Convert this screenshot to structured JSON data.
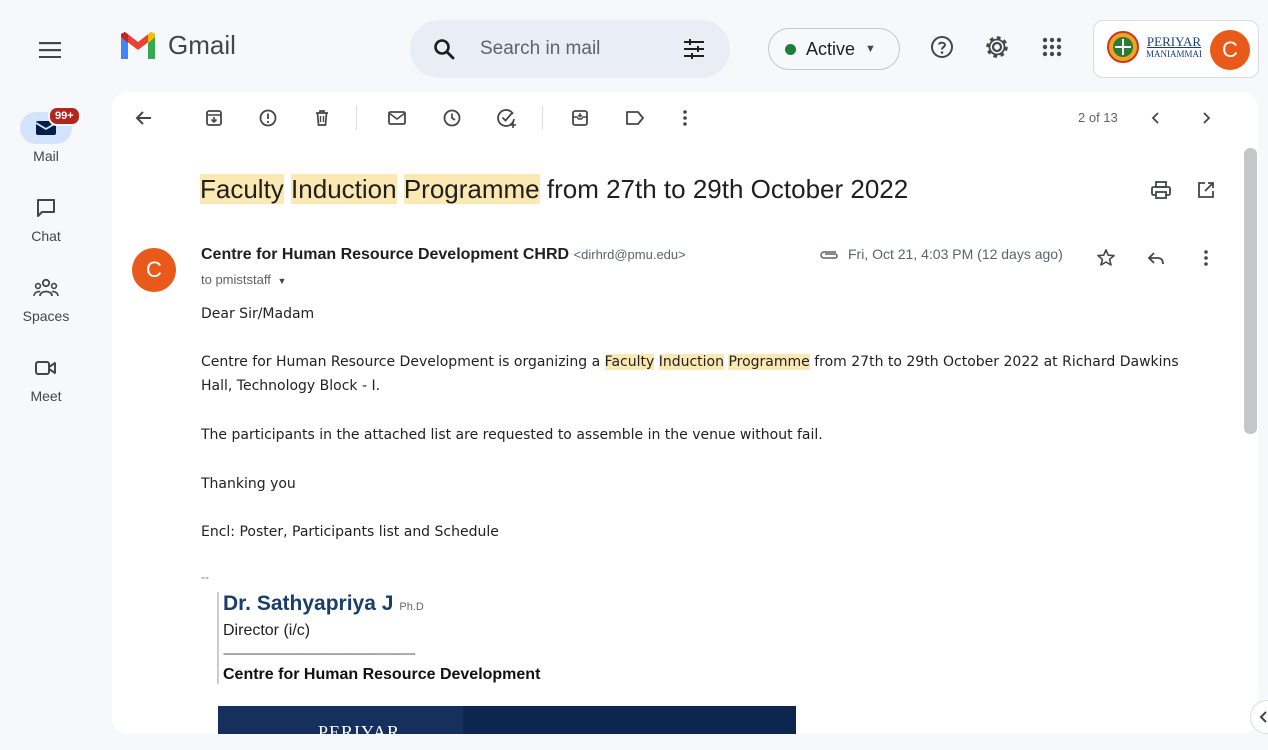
{
  "app": {
    "name": "Gmail"
  },
  "search": {
    "placeholder": "Search in mail"
  },
  "status": {
    "label": "Active",
    "color": "#188038"
  },
  "account": {
    "initial": "C",
    "org_line1": "PERIYAR",
    "org_line2": "MANIAMMAI"
  },
  "nav": {
    "mail_label": "Mail",
    "mail_badge": "99+",
    "chat_label": "Chat",
    "spaces_label": "Spaces",
    "meet_label": "Meet"
  },
  "toolbar": {
    "pager": "2 of 13"
  },
  "message": {
    "subject_parts": [
      "Faculty",
      "Induction",
      "Programme",
      "from 27th to 29th October 2022"
    ],
    "sender_initial": "C",
    "sender_name": "Centre for Human Resource Development CHRD",
    "sender_email": "<dirhrd@pmu.edu>",
    "to": "to pmiststaff",
    "date": "Fri, Oct 21, 4:03 PM (12 days ago)",
    "greeting": "Dear Sir/Madam",
    "p1_before": "Centre for Human Resource Development is organizing a",
    "p1_hl1": "Faculty",
    "p1_hl2": "Induction",
    "p1_hl3": "Programme",
    "p1_after": "from 27th to 29th October 2022 at Richard Dawkins Hall, Technology Block - I.",
    "p2": "The participants in the attached list are requested to assemble in the venue without fail.",
    "p3": "Thanking you",
    "p4": "Encl: Poster, Participants list and Schedule",
    "sig_dash": "--",
    "sig_name": "Dr. Sathyapriya J",
    "sig_degree": "Ph.D",
    "sig_role": "Director (i/c)",
    "sig_rule": "----------------------------------------------------------------",
    "sig_org": "Centre for Human Resource Development",
    "banner_text": "PERIYAR"
  },
  "colors": {
    "accent": "#e8591a",
    "highlight": "#fce8b2",
    "badge": "#b3261e"
  }
}
